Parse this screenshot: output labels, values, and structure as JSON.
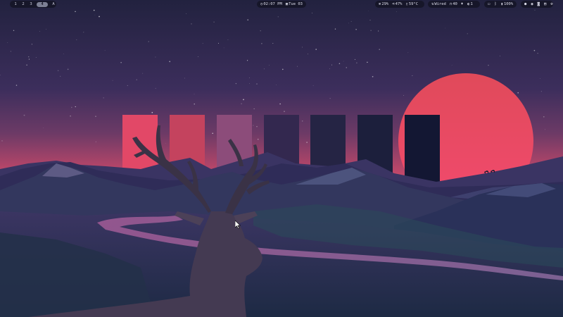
{
  "workspaces": {
    "items": [
      "1",
      "2",
      "3",
      "4"
    ],
    "active_index": 3,
    "launcher_glyph": "A"
  },
  "clock": {
    "icon": "clock-icon",
    "time": "02:07 PM",
    "calendar_icon": "calendar-icon",
    "date": "Tue 03"
  },
  "system": {
    "cpu_icon": "cpu-icon",
    "cpu": "29%",
    "memory_icon": "memory-icon",
    "memory": "47%",
    "temp_icon": "thermometer-icon",
    "temp": "59°C"
  },
  "network": {
    "icon": "network-icon",
    "label": "Wired",
    "headphone_icon": "headphone-icon",
    "volume": "40",
    "mic_icon": "microphone-icon",
    "brightness_icon": "brightness-icon",
    "brightness": "1"
  },
  "status": {
    "display_icon": "monitor-icon",
    "bluetooth_icon": "bluetooth-icon",
    "battery_icon": "battery-icon",
    "battery": "100%"
  },
  "tray": {
    "icons": [
      "discord-icon",
      "steam-icon",
      "chat-icon",
      "files-icon",
      "settings-icon"
    ]
  },
  "colors": {
    "bar_bg": "#161629",
    "active_ws": "#7d8095",
    "sun": "#e8405f",
    "sky_top": "#24244a",
    "sky_bottom": "#c9476a",
    "palette": [
      "#e24867",
      "#c4435e",
      "#8c4c7a",
      "#33284f",
      "#252444",
      "#1c1f3c",
      "#131733"
    ]
  }
}
